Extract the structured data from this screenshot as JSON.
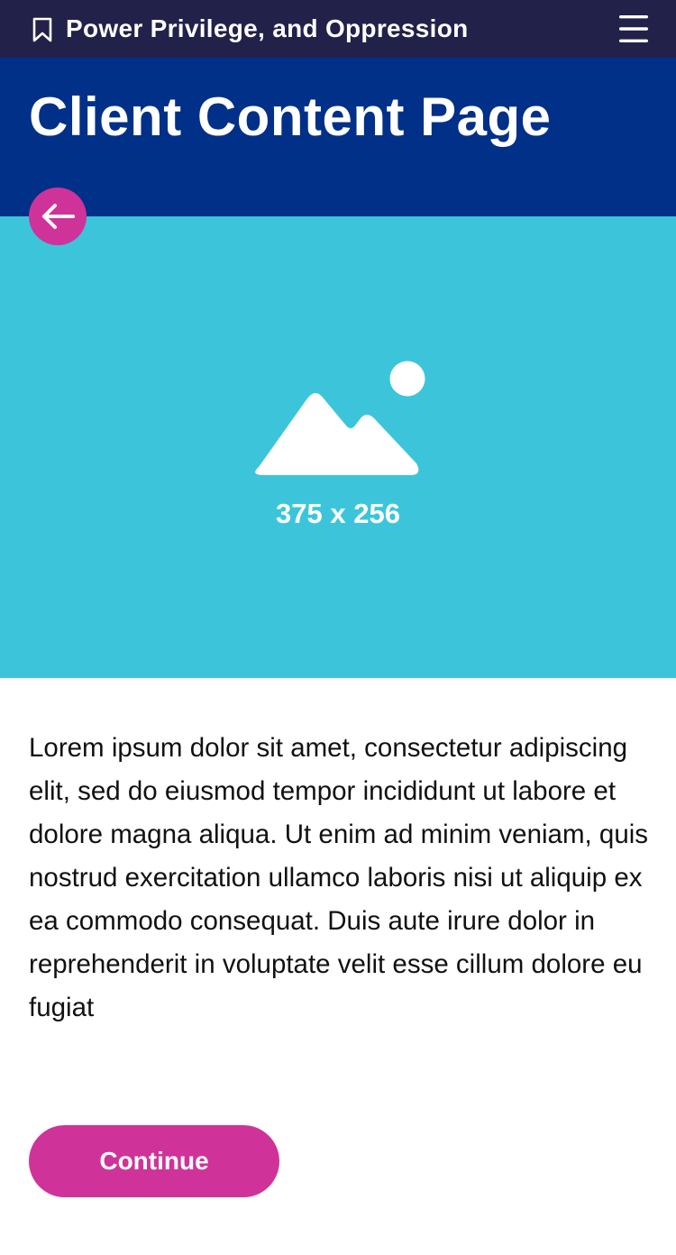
{
  "app_bar": {
    "title": "Power Privilege, and Oppression",
    "bookmark_icon": "bookmark-icon",
    "menu_icon": "hamburger-menu-icon"
  },
  "header": {
    "title": "Client Content Page"
  },
  "back_button": {
    "icon": "arrow-left-icon"
  },
  "hero": {
    "placeholder_icon": "image-placeholder-icon",
    "placeholder_label": "375 x 256"
  },
  "content": {
    "body": "Lorem ipsum dolor sit amet, consectetur adipiscing elit, sed do eiusmod tempor incididunt ut labore et dolore magna aliqua. Ut enim ad minim veniam, quis nostrud exercitation ullamco laboris nisi ut aliquip ex ea commodo consequat. Duis aute irure dolor in reprehenderit in voluptate velit esse cillum dolore eu fugiat"
  },
  "actions": {
    "continue_label": "Continue"
  },
  "colors": {
    "app_bar_bg": "#22214a",
    "header_bg": "#003087",
    "hero_bg": "#3cc5da",
    "accent": "#cf3399",
    "text": "#111111"
  }
}
